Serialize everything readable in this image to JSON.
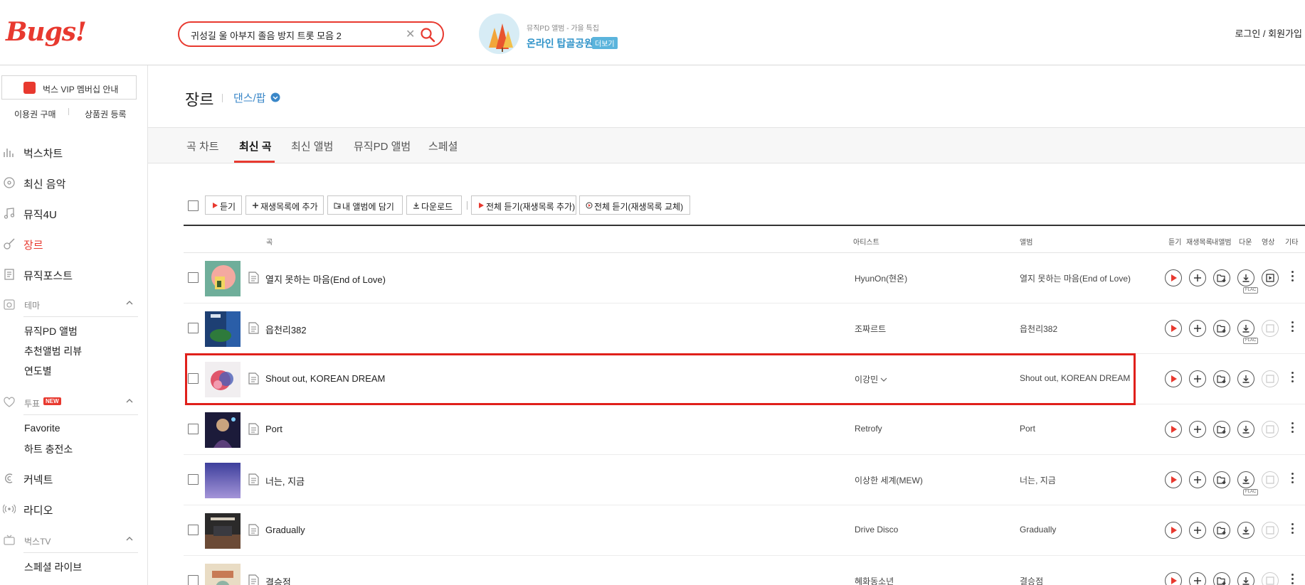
{
  "header": {
    "logo": "Bugs!",
    "search": {
      "query": "귀성길 울 아부지 졸음 방지 트롯 모음 2"
    },
    "promo": {
      "subtitle": "뮤직PD 앨범 - 가을 특집",
      "title": "온라인 탑골공원",
      "more_label": "더보기"
    },
    "login": "로그인 / 회원가입"
  },
  "sidebar": {
    "vip_label": "벅스 VIP 멤버십 안내",
    "buy_ticket": "이용권 구매",
    "register_product": "상품권 등록",
    "items": [
      {
        "label": "벅스차트",
        "icon": "chart-icon"
      },
      {
        "label": "최신 음악",
        "icon": "disc-icon"
      },
      {
        "label": "뮤직4U",
        "icon": "music-note-icon"
      },
      {
        "label": "장르",
        "icon": "guitar-icon"
      },
      {
        "label": "뮤직포스트",
        "icon": "post-icon"
      }
    ],
    "theme": {
      "label": "테마",
      "subs": [
        "뮤직PD 앨범",
        "추천앨범 리뷰",
        "연도별"
      ]
    },
    "vote": {
      "label": "투표",
      "badge": "NEW",
      "subs": [
        "Favorite",
        "하트 충전소"
      ]
    },
    "connect": "커넥트",
    "radio": "라디오",
    "bugstv": {
      "label": "벅스TV",
      "subs": [
        "스페셜 라이브"
      ]
    }
  },
  "main": {
    "title": "장르",
    "genre": "댄스/팝",
    "tabs": [
      "곡 차트",
      "최신 곡",
      "최신 앨범",
      "뮤직PD 앨범",
      "스페셜"
    ],
    "active_tab": "최신 곡",
    "toolbar": {
      "listen": "듣기",
      "add_playlist": "재생목록에 추가",
      "add_album": "내 앨범에 담기",
      "download": "다운로드",
      "play_all_add": "전체 듣기(재생목록 추가)",
      "play_all_replace": "전체 듣기(재생목록 교체)"
    },
    "columns": {
      "song": "곡",
      "artist": "아티스트",
      "album": "앨범",
      "listen": "듣기",
      "playlist": "재생목록",
      "my_album": "내앨범",
      "down": "다운",
      "video": "영상",
      "etc": "기타"
    },
    "flac_label": "FLAC",
    "rows": [
      {
        "title": "열지 못하는 마음(End of Love)",
        "artist": "HyunOn(현온)",
        "album": "열지 못하는 마음(End of Love)"
      },
      {
        "title": "읍천리382",
        "artist": "조짜르트",
        "album": "읍천리382"
      },
      {
        "title": "Shout out, KOREAN DREAM",
        "artist": "이강민",
        "album": "Shout out, KOREAN DREAM"
      },
      {
        "title": "Port",
        "artist": "Retrofy",
        "album": "Port"
      },
      {
        "title": "너는, 지금",
        "artist": "이상한 세계(MEW)",
        "album": "너는, 지금"
      },
      {
        "title": "Gradually",
        "artist": "Drive Disco",
        "album": "Gradually"
      },
      {
        "title": "결승점",
        "artist": "혜화동소년",
        "album": "결승점"
      }
    ]
  },
  "colors": {
    "accent": "#e8392f",
    "link": "#3a87c8",
    "highlight": "#e0201b"
  }
}
